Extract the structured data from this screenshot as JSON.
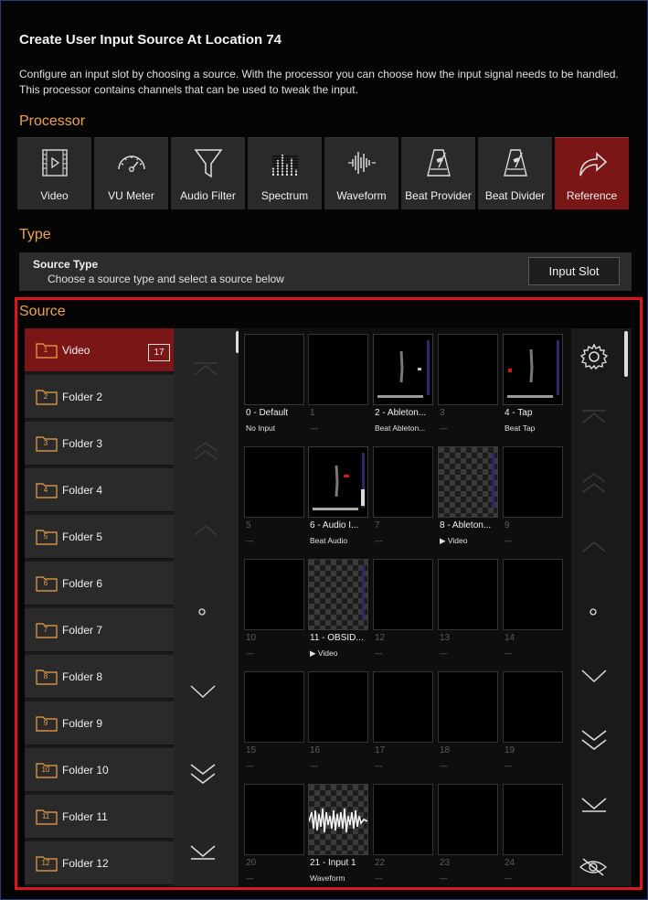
{
  "dialog": {
    "title": "Create User Input Source At Location 74",
    "description": "Configure an input slot by choosing a source. With the processor you can choose how the input signal needs to be handled. This processor contains channels that can be used to tweak the input."
  },
  "processor": {
    "section_label": "Processor",
    "buttons": [
      {
        "label": "Video",
        "icon": "video-icon"
      },
      {
        "label": "VU Meter",
        "icon": "vu-meter-icon"
      },
      {
        "label": "Audio Filter",
        "icon": "funnel-icon"
      },
      {
        "label": "Spectrum",
        "icon": "spectrum-icon"
      },
      {
        "label": "Waveform",
        "icon": "waveform-icon"
      },
      {
        "label": "Beat Provider",
        "icon": "metronome-icon"
      },
      {
        "label": "Beat Divider",
        "icon": "metronome-icon"
      },
      {
        "label": "Reference",
        "icon": "share-arrow-icon",
        "active": true
      }
    ]
  },
  "type": {
    "section_label": "Type",
    "title": "Source Type",
    "subtitle": "Choose a source type and select a source below",
    "button_label": "Input Slot"
  },
  "source": {
    "section_label": "Source",
    "folders": [
      {
        "num": "1",
        "label": "Video",
        "count": "17",
        "active": true
      },
      {
        "num": "2",
        "label": "Folder 2"
      },
      {
        "num": "3",
        "label": "Folder 3"
      },
      {
        "num": "4",
        "label": "Folder 4"
      },
      {
        "num": "5",
        "label": "Folder 5"
      },
      {
        "num": "6",
        "label": "Folder 6"
      },
      {
        "num": "7",
        "label": "Folder 7"
      },
      {
        "num": "8",
        "label": "Folder 8"
      },
      {
        "num": "9",
        "label": "Folder 9"
      },
      {
        "num": "10",
        "label": "Folder 10"
      },
      {
        "num": "11",
        "label": "Folder 11"
      },
      {
        "num": "12",
        "label": "Folder 12"
      }
    ],
    "slots": [
      {
        "label": "0 - Default",
        "sub": "No Input",
        "preview": "dark"
      },
      {
        "label": "1",
        "sub": "---",
        "preview": "empty"
      },
      {
        "label": "2 - Ableton...",
        "sub": "Beat  Ableton...",
        "preview": "beat"
      },
      {
        "label": "3",
        "sub": "---",
        "preview": "empty"
      },
      {
        "label": "4 - Tap",
        "sub": "Beat Tap",
        "preview": "tap"
      },
      {
        "label": "5",
        "sub": "---",
        "preview": "empty"
      },
      {
        "label": "6 - Audio I...",
        "sub": "Beat Audio",
        "preview": "audio"
      },
      {
        "label": "7",
        "sub": "---",
        "preview": "empty"
      },
      {
        "label": "8 - Ableton...",
        "sub": "▶ Video",
        "preview": "checker"
      },
      {
        "label": "9",
        "sub": "---",
        "preview": "empty"
      },
      {
        "label": "10",
        "sub": "---",
        "preview": "empty"
      },
      {
        "label": "11 - OBSID...",
        "sub": "▶ Video",
        "preview": "checker"
      },
      {
        "label": "12",
        "sub": "---",
        "preview": "empty"
      },
      {
        "label": "13",
        "sub": "---",
        "preview": "empty"
      },
      {
        "label": "14",
        "sub": "---",
        "preview": "empty"
      },
      {
        "label": "15",
        "sub": "---",
        "preview": "empty"
      },
      {
        "label": "16",
        "sub": "---",
        "preview": "empty"
      },
      {
        "label": "17",
        "sub": "---",
        "preview": "empty"
      },
      {
        "label": "18",
        "sub": "---",
        "preview": "empty"
      },
      {
        "label": "19",
        "sub": "---",
        "preview": "empty"
      },
      {
        "label": "20",
        "sub": "---",
        "preview": "empty"
      },
      {
        "label": "21 - Input 1",
        "sub": "Waveform",
        "preview": "wave"
      },
      {
        "label": "22",
        "sub": "---",
        "preview": "empty"
      },
      {
        "label": "23",
        "sub": "---",
        "preview": "empty"
      },
      {
        "label": "24",
        "sub": "---",
        "preview": "empty"
      }
    ]
  },
  "colors": {
    "accent": "#f0a24a",
    "active_red": "#7a1616",
    "highlight_border": "#e0141c"
  }
}
